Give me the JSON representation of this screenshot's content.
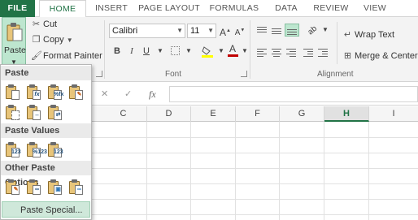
{
  "ribbon_tabs": {
    "file": "FILE",
    "home": "HOME",
    "insert": "INSERT",
    "page_layout": "PAGE LAYOUT",
    "formulas": "FORMULAS",
    "data": "DATA",
    "review": "REVIEW",
    "view": "VIEW"
  },
  "clipboard": {
    "paste_label": "Paste",
    "cut_label": "Cut",
    "copy_label": "Copy",
    "format_painter_label": "Format Painter"
  },
  "font": {
    "family": "Calibri",
    "size": "11",
    "group_label": "Font",
    "bold": "B",
    "italic": "I",
    "underline": "U"
  },
  "alignment": {
    "wrap_text_label": "Wrap Text",
    "merge_center_label": "Merge & Center",
    "group_label": "Alignment"
  },
  "formula_bar": {
    "fx": "fx",
    "cancel": "✕",
    "enter": "✓"
  },
  "grid": {
    "columns": [
      "C",
      "D",
      "E",
      "F",
      "G",
      "H",
      "I"
    ],
    "selected_column": "H"
  },
  "paste_menu": {
    "section_paste": "Paste",
    "section_paste_values": "Paste Values",
    "section_other": "Other Paste Options",
    "paste_special": "Paste Special...",
    "values_badges": [
      "123",
      "%123",
      "123"
    ]
  },
  "colors": {
    "accent": "#217346",
    "pressed": "#bde6cf",
    "highlight_fill": "#ffff00",
    "font_color": "#c00000"
  }
}
